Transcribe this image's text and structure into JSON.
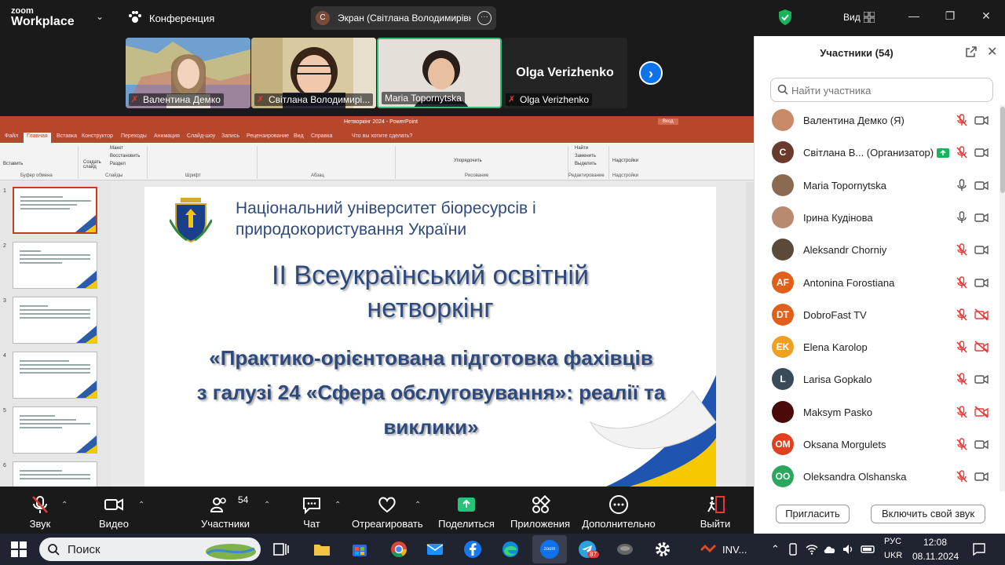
{
  "topbar": {
    "logo_line1": "zoom",
    "logo_line2": "Workplace",
    "meeting_label": "Конференция",
    "share_initial": "С",
    "share_label": "Экран (Світлана Володимирівна",
    "view_label": "Вид"
  },
  "tiles": [
    {
      "name": "Валентина Демко",
      "bg": "#7aa6c9"
    },
    {
      "name": "Світлана Володимирі...",
      "bg": "#c9b58a"
    },
    {
      "name": "Maria Topornytska",
      "bg": "#ded9d2"
    },
    {
      "name": "Olga Verizhenko",
      "big_name": "Olga Verizhenko",
      "bg": "#242424"
    }
  ],
  "ppt": {
    "title": "Нетворкінг 2024 - PowerPoint",
    "login": "Вход",
    "tabs": [
      "Файл",
      "Главная",
      "Вставка",
      "Конструктор",
      "Переходы",
      "Анимация",
      "Слайд-шоу",
      "Запись",
      "Рецензирование",
      "Вид",
      "Справка",
      "Что вы хотите сделать?"
    ],
    "groups": [
      "Буфер обмена",
      "Слайды",
      "Шрифт",
      "Абзац",
      "Рисование",
      "Редактирование",
      "Надстройки"
    ],
    "ribbon_items": [
      "Вставить",
      "Создать слайд",
      "Макет",
      "Восстановить",
      "Раздел",
      "Найти",
      "Заменить",
      "Выделить",
      "Упорядочить",
      "Надстройки"
    ]
  },
  "slide": {
    "university": "Національний університет біоресурсів і природокористування України",
    "title_line1": "ІІ Всеукраїнський освітній",
    "title_line2": "нетворкінг",
    "subtitle_line1": "«Практико-орієнтована підготовка фахівців",
    "subtitle_line2": "з галузі 24 «Сфера обслуговування»: реалії та",
    "subtitle_line3": "виклики»"
  },
  "toolbar": {
    "mute": "Звук",
    "video": "Видео",
    "participants": "Участники",
    "participants_count": "54",
    "chat": "Чат",
    "react": "Отреагировать",
    "share": "Поделиться",
    "apps": "Приложения",
    "more": "Дополнительно",
    "leave": "Выйти"
  },
  "panel": {
    "title": "Участники (54)",
    "search_placeholder": "Найти участника",
    "invite": "Пригласить",
    "unmute_self": "Включить свой звук",
    "participants": [
      {
        "name": "Валентина Демко (Я)",
        "initials": "",
        "color": "#c98a6a",
        "mic": "muted",
        "cam": "on"
      },
      {
        "name": "Світлана В...  (Организатор)",
        "initials": "С",
        "color": "#6b3a2e",
        "mic": "muted",
        "cam": "on",
        "share": true
      },
      {
        "name": "Maria Topornytska",
        "initials": "",
        "color": "#8a6a50",
        "mic": "on",
        "cam": "on"
      },
      {
        "name": "Ірина  Кудінова",
        "initials": "",
        "color": "#b88a70",
        "mic": "on",
        "cam": "on"
      },
      {
        "name": "Aleksandr Chorniy",
        "initials": "",
        "color": "#5a4a3a",
        "mic": "muted",
        "cam": "on"
      },
      {
        "name": "Antonina Forostiana",
        "initials": "AF",
        "color": "#e0601a",
        "mic": "muted",
        "cam": "on"
      },
      {
        "name": "DobroFast TV",
        "initials": "DT",
        "color": "#e0601a",
        "mic": "muted",
        "cam": "off"
      },
      {
        "name": "Elena Karolop",
        "initials": "EK",
        "color": "#f0a020",
        "mic": "muted",
        "cam": "off"
      },
      {
        "name": "Larisa Gopkalo",
        "initials": "L",
        "color": "#3a4a5a",
        "mic": "muted",
        "cam": "on"
      },
      {
        "name": "Maksym Pasko",
        "initials": "",
        "color": "#4a0a0a",
        "mic": "muted",
        "cam": "off"
      },
      {
        "name": "Oksana Morgulets",
        "initials": "OM",
        "color": "#e04020",
        "mic": "muted",
        "cam": "on"
      },
      {
        "name": "Oleksandra Olshanska",
        "initials": "OO",
        "color": "#2aa860",
        "mic": "muted",
        "cam": "on"
      }
    ]
  },
  "taskbar": {
    "search": "Поиск",
    "inv": "INV...",
    "lang1": "РУС",
    "lang2": "UKR",
    "time": "12:08",
    "date": "08.11.2024",
    "tg_badge": "87"
  }
}
